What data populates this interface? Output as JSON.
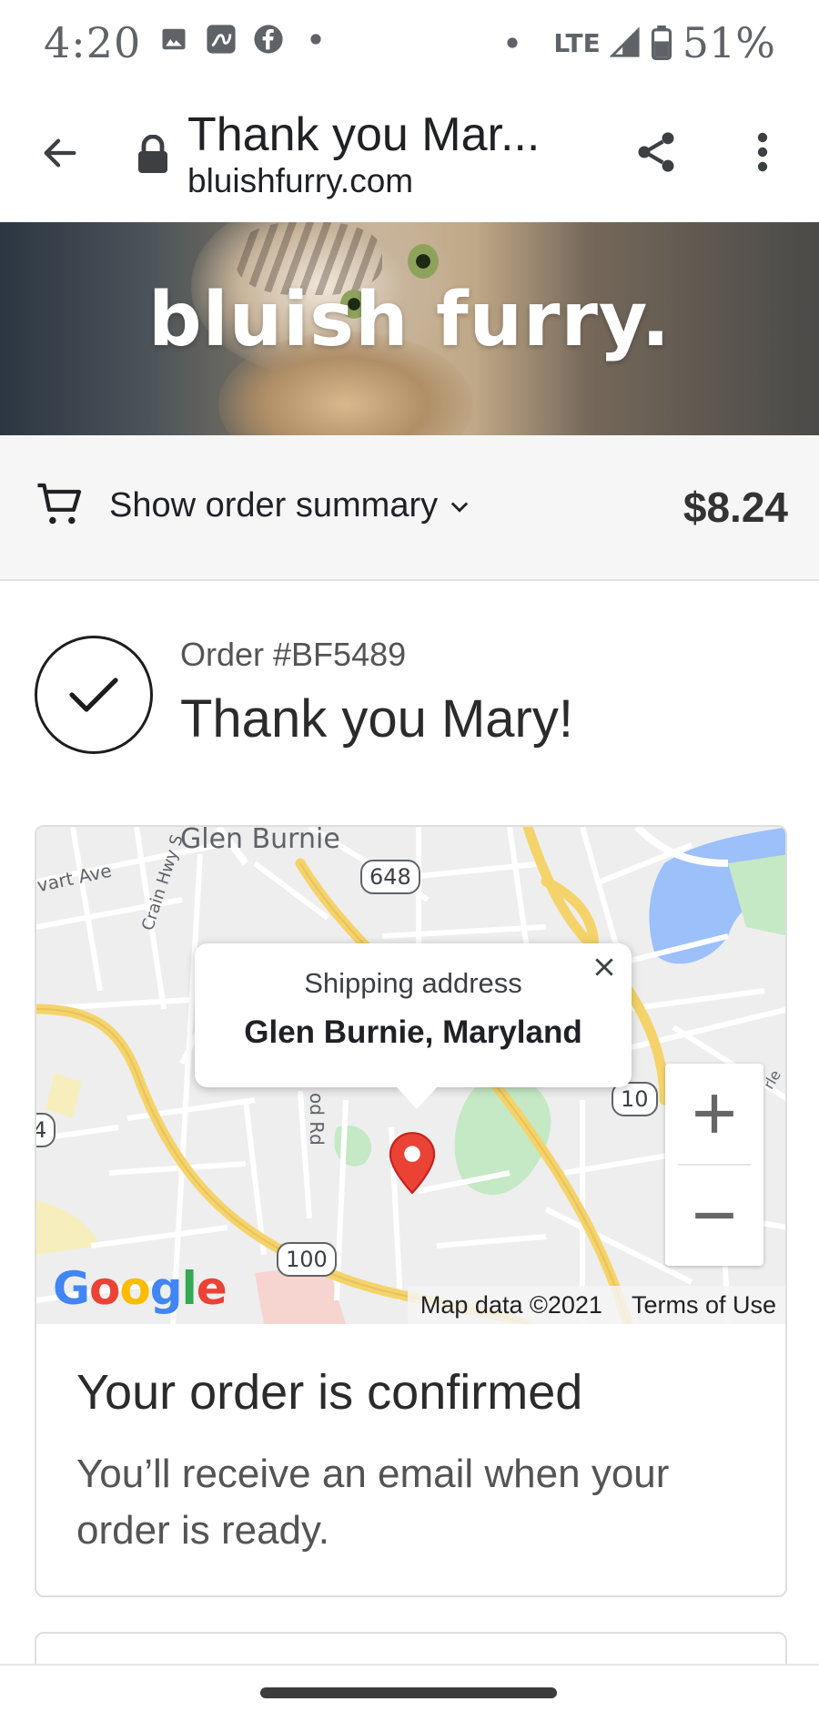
{
  "status_bar": {
    "time": "4:20",
    "left_icons": [
      "image-icon",
      "app-icon",
      "facebook-icon",
      "dot-icon"
    ],
    "network": "LTE",
    "battery": "51%"
  },
  "browser": {
    "title": "Thank you Mar...",
    "url": "bluishfurry.com"
  },
  "hero": {
    "brand": "bluish furry."
  },
  "summary": {
    "toggle_label": "Show order summary",
    "total": "$8.24"
  },
  "order": {
    "number": "Order #BF5489",
    "thank_you": "Thank you Mary!"
  },
  "map": {
    "labels": {
      "glen_burnie": "Glen Burnie",
      "stewart_ave": "vart Ave",
      "crain_hwy": "Crain Hwy S",
      "wood_rd": "od Rd",
      "edge_label": "rle"
    },
    "shields": {
      "r648": "648",
      "r10": "10",
      "r100": "100",
      "r4": "4"
    },
    "popup": {
      "title": "Shipping address",
      "address": "Glen Burnie, Maryland"
    },
    "google": "Google",
    "map_data": "Map data ©2021",
    "terms": "Terms of Use"
  },
  "confirmation": {
    "title": "Your order is confirmed",
    "text": "You’ll receive an email when your order is ready."
  },
  "colors": {
    "pin": "#ea4335",
    "road_major": "#f5d36b",
    "water": "#9cc0f9",
    "park": "#c5e8c5"
  }
}
